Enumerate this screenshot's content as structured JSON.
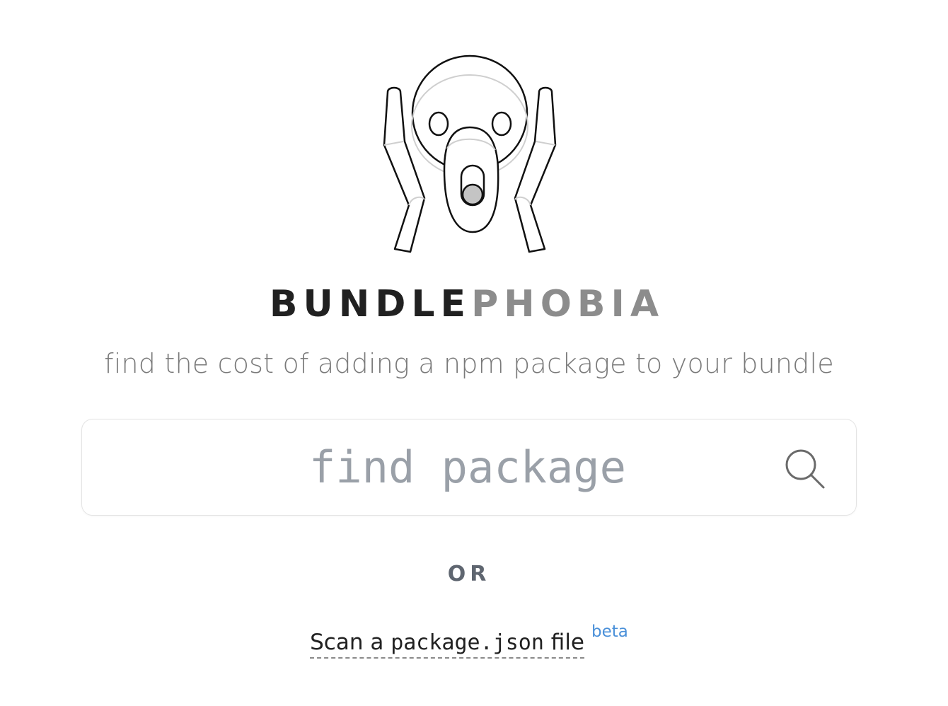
{
  "brand": {
    "name_part_1": "BUNDLE",
    "name_part_2": "PHOBIA",
    "dark_color": "#212121",
    "light_color": "#8c8c8c"
  },
  "logo": {
    "icon": "screaming-face-logo"
  },
  "tagline": "find the cost of adding a npm package to your bundle",
  "search": {
    "placeholder": "find package",
    "value": "",
    "icon": "search-icon"
  },
  "separator": "OR",
  "scan": {
    "prefix": "Scan a ",
    "file_name": "package.json",
    "suffix": " file",
    "badge": "beta",
    "badge_color": "#4a90d9"
  }
}
